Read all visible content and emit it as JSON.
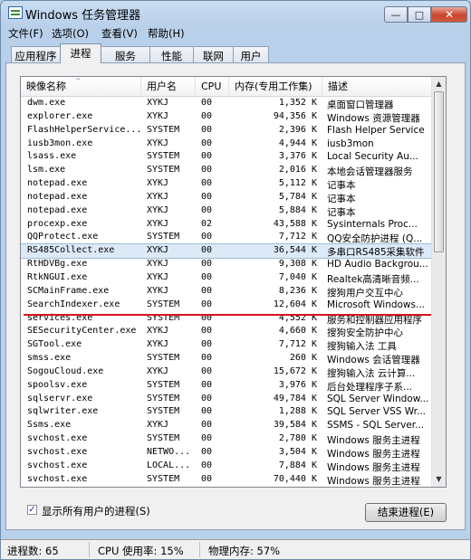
{
  "window": {
    "title": "Windows 任务管理器"
  },
  "menu": [
    "文件(F)",
    "选项(O)",
    "查看(V)",
    "帮助(H)"
  ],
  "tabs": [
    "应用程序",
    "进程",
    "服务",
    "性能",
    "联网",
    "用户"
  ],
  "active_tab": "进程",
  "columns": [
    "映像名称",
    "用户名",
    "CPU",
    "内存(专用工作集)",
    "描述"
  ],
  "processes": [
    {
      "name": "dwm.exe",
      "user": "XYKJ",
      "cpu": "00",
      "mem": "1,352 K",
      "desc": "桌面窗口管理器"
    },
    {
      "name": "explorer.exe",
      "user": "XYKJ",
      "cpu": "00",
      "mem": "94,356 K",
      "desc": "Windows 资源管理器"
    },
    {
      "name": "FlashHelperService...",
      "user": "SYSTEM",
      "cpu": "00",
      "mem": "2,396 K",
      "desc": "Flash Helper Service"
    },
    {
      "name": "iusb3mon.exe",
      "user": "XYKJ",
      "cpu": "00",
      "mem": "4,944 K",
      "desc": "iusb3mon"
    },
    {
      "name": "lsass.exe",
      "user": "SYSTEM",
      "cpu": "00",
      "mem": "3,376 K",
      "desc": "Local Security Au..."
    },
    {
      "name": "lsm.exe",
      "user": "SYSTEM",
      "cpu": "00",
      "mem": "2,016 K",
      "desc": "本地会话管理器服务"
    },
    {
      "name": "notepad.exe",
      "user": "XYKJ",
      "cpu": "00",
      "mem": "5,112 K",
      "desc": "记事本"
    },
    {
      "name": "notepad.exe",
      "user": "XYKJ",
      "cpu": "00",
      "mem": "5,784 K",
      "desc": "记事本"
    },
    {
      "name": "notepad.exe",
      "user": "XYKJ",
      "cpu": "00",
      "mem": "5,884 K",
      "desc": "记事本"
    },
    {
      "name": "procexp.exe",
      "user": "XYKJ",
      "cpu": "02",
      "mem": "43,588 K",
      "desc": "Sysinternals Proc..."
    },
    {
      "name": "QQProtect.exe",
      "user": "SYSTEM",
      "cpu": "00",
      "mem": "7,712 K",
      "desc": "QQ安全防护进程 (Q..."
    },
    {
      "name": "RS485Collect.exe",
      "user": "XYKJ",
      "cpu": "00",
      "mem": "36,544 K",
      "desc": "多串口RS485采集软件"
    },
    {
      "name": "RtHDVBg.exe",
      "user": "XYKJ",
      "cpu": "00",
      "mem": "9,308 K",
      "desc": "HD Audio Backgrou..."
    },
    {
      "name": "RtkNGUI.exe",
      "user": "XYKJ",
      "cpu": "00",
      "mem": "7,040 K",
      "desc": "Realtek高清晰音频..."
    },
    {
      "name": "SCMainFrame.exe",
      "user": "XYKJ",
      "cpu": "00",
      "mem": "8,236 K",
      "desc": "搜狗用户交互中心"
    },
    {
      "name": "SearchIndexer.exe",
      "user": "SYSTEM",
      "cpu": "00",
      "mem": "12,604 K",
      "desc": "Microsoft Windows..."
    },
    {
      "name": "services.exe",
      "user": "SYSTEM",
      "cpu": "00",
      "mem": "4,552 K",
      "desc": "服务和控制器应用程序"
    },
    {
      "name": "SESecurityCenter.exe",
      "user": "XYKJ",
      "cpu": "00",
      "mem": "4,660 K",
      "desc": "搜狗安全防护中心"
    },
    {
      "name": "SGTool.exe",
      "user": "XYKJ",
      "cpu": "00",
      "mem": "7,712 K",
      "desc": "搜狗输入法 工具"
    },
    {
      "name": "smss.exe",
      "user": "SYSTEM",
      "cpu": "00",
      "mem": "260 K",
      "desc": "Windows 会话管理器"
    },
    {
      "name": "SogouCloud.exe",
      "user": "XYKJ",
      "cpu": "00",
      "mem": "15,672 K",
      "desc": "搜狗输入法 云计算..."
    },
    {
      "name": "spoolsv.exe",
      "user": "SYSTEM",
      "cpu": "00",
      "mem": "3,976 K",
      "desc": "后台处理程序子系..."
    },
    {
      "name": "sqlservr.exe",
      "user": "SYSTEM",
      "cpu": "00",
      "mem": "49,784 K",
      "desc": "SQL Server Window..."
    },
    {
      "name": "sqlwriter.exe",
      "user": "SYSTEM",
      "cpu": "00",
      "mem": "1,288 K",
      "desc": "SQL Server VSS Wr..."
    },
    {
      "name": "Ssms.exe",
      "user": "XYKJ",
      "cpu": "00",
      "mem": "39,584 K",
      "desc": "SSMS - SQL Server..."
    },
    {
      "name": "svchost.exe",
      "user": "SYSTEM",
      "cpu": "00",
      "mem": "2,780 K",
      "desc": "Windows 服务主进程"
    },
    {
      "name": "svchost.exe",
      "user": "NETWO...",
      "cpu": "00",
      "mem": "3,504 K",
      "desc": "Windows 服务主进程"
    },
    {
      "name": "svchost.exe",
      "user": "LOCAL...",
      "cpu": "00",
      "mem": "7,884 K",
      "desc": "Windows 服务主进程"
    },
    {
      "name": "svchost.exe",
      "user": "SYSTEM",
      "cpu": "00",
      "mem": "70,440 K",
      "desc": "Windows 服务主进程"
    }
  ],
  "show_all_users": {
    "label": "显示所有用户的进程(S)",
    "checked": true,
    "check_mark": "✓"
  },
  "end_process_button": "结束进程(E)",
  "status": {
    "processes": "进程数: 65",
    "cpu": "CPU 使用率: 15%",
    "memory": "物理内存: 57%"
  },
  "window_buttons": {
    "minimize": "—",
    "maximize": "□",
    "close": "✕"
  },
  "scroll_arrows": {
    "up": "▲",
    "down": "▼"
  },
  "sort_indicator": "^",
  "colors": {
    "highlight_line": "#d8121f",
    "selected_row": "#dce9f7"
  }
}
